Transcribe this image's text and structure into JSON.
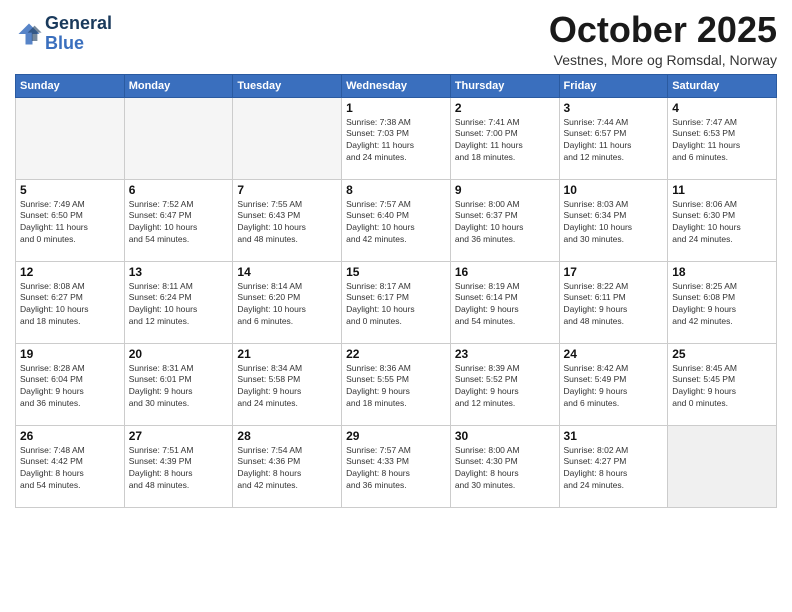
{
  "logo": {
    "line1": "General",
    "line2": "Blue"
  },
  "title": "October 2025",
  "subtitle": "Vestnes, More og Romsdal, Norway",
  "days_of_week": [
    "Sunday",
    "Monday",
    "Tuesday",
    "Wednesday",
    "Thursday",
    "Friday",
    "Saturday"
  ],
  "weeks": [
    [
      {
        "day": "",
        "info": ""
      },
      {
        "day": "",
        "info": ""
      },
      {
        "day": "",
        "info": ""
      },
      {
        "day": "1",
        "info": "Sunrise: 7:38 AM\nSunset: 7:03 PM\nDaylight: 11 hours\nand 24 minutes."
      },
      {
        "day": "2",
        "info": "Sunrise: 7:41 AM\nSunset: 7:00 PM\nDaylight: 11 hours\nand 18 minutes."
      },
      {
        "day": "3",
        "info": "Sunrise: 7:44 AM\nSunset: 6:57 PM\nDaylight: 11 hours\nand 12 minutes."
      },
      {
        "day": "4",
        "info": "Sunrise: 7:47 AM\nSunset: 6:53 PM\nDaylight: 11 hours\nand 6 minutes."
      }
    ],
    [
      {
        "day": "5",
        "info": "Sunrise: 7:49 AM\nSunset: 6:50 PM\nDaylight: 11 hours\nand 0 minutes."
      },
      {
        "day": "6",
        "info": "Sunrise: 7:52 AM\nSunset: 6:47 PM\nDaylight: 10 hours\nand 54 minutes."
      },
      {
        "day": "7",
        "info": "Sunrise: 7:55 AM\nSunset: 6:43 PM\nDaylight: 10 hours\nand 48 minutes."
      },
      {
        "day": "8",
        "info": "Sunrise: 7:57 AM\nSunset: 6:40 PM\nDaylight: 10 hours\nand 42 minutes."
      },
      {
        "day": "9",
        "info": "Sunrise: 8:00 AM\nSunset: 6:37 PM\nDaylight: 10 hours\nand 36 minutes."
      },
      {
        "day": "10",
        "info": "Sunrise: 8:03 AM\nSunset: 6:34 PM\nDaylight: 10 hours\nand 30 minutes."
      },
      {
        "day": "11",
        "info": "Sunrise: 8:06 AM\nSunset: 6:30 PM\nDaylight: 10 hours\nand 24 minutes."
      }
    ],
    [
      {
        "day": "12",
        "info": "Sunrise: 8:08 AM\nSunset: 6:27 PM\nDaylight: 10 hours\nand 18 minutes."
      },
      {
        "day": "13",
        "info": "Sunrise: 8:11 AM\nSunset: 6:24 PM\nDaylight: 10 hours\nand 12 minutes."
      },
      {
        "day": "14",
        "info": "Sunrise: 8:14 AM\nSunset: 6:20 PM\nDaylight: 10 hours\nand 6 minutes."
      },
      {
        "day": "15",
        "info": "Sunrise: 8:17 AM\nSunset: 6:17 PM\nDaylight: 10 hours\nand 0 minutes."
      },
      {
        "day": "16",
        "info": "Sunrise: 8:19 AM\nSunset: 6:14 PM\nDaylight: 9 hours\nand 54 minutes."
      },
      {
        "day": "17",
        "info": "Sunrise: 8:22 AM\nSunset: 6:11 PM\nDaylight: 9 hours\nand 48 minutes."
      },
      {
        "day": "18",
        "info": "Sunrise: 8:25 AM\nSunset: 6:08 PM\nDaylight: 9 hours\nand 42 minutes."
      }
    ],
    [
      {
        "day": "19",
        "info": "Sunrise: 8:28 AM\nSunset: 6:04 PM\nDaylight: 9 hours\nand 36 minutes."
      },
      {
        "day": "20",
        "info": "Sunrise: 8:31 AM\nSunset: 6:01 PM\nDaylight: 9 hours\nand 30 minutes."
      },
      {
        "day": "21",
        "info": "Sunrise: 8:34 AM\nSunset: 5:58 PM\nDaylight: 9 hours\nand 24 minutes."
      },
      {
        "day": "22",
        "info": "Sunrise: 8:36 AM\nSunset: 5:55 PM\nDaylight: 9 hours\nand 18 minutes."
      },
      {
        "day": "23",
        "info": "Sunrise: 8:39 AM\nSunset: 5:52 PM\nDaylight: 9 hours\nand 12 minutes."
      },
      {
        "day": "24",
        "info": "Sunrise: 8:42 AM\nSunset: 5:49 PM\nDaylight: 9 hours\nand 6 minutes."
      },
      {
        "day": "25",
        "info": "Sunrise: 8:45 AM\nSunset: 5:45 PM\nDaylight: 9 hours\nand 0 minutes."
      }
    ],
    [
      {
        "day": "26",
        "info": "Sunrise: 7:48 AM\nSunset: 4:42 PM\nDaylight: 8 hours\nand 54 minutes."
      },
      {
        "day": "27",
        "info": "Sunrise: 7:51 AM\nSunset: 4:39 PM\nDaylight: 8 hours\nand 48 minutes."
      },
      {
        "day": "28",
        "info": "Sunrise: 7:54 AM\nSunset: 4:36 PM\nDaylight: 8 hours\nand 42 minutes."
      },
      {
        "day": "29",
        "info": "Sunrise: 7:57 AM\nSunset: 4:33 PM\nDaylight: 8 hours\nand 36 minutes."
      },
      {
        "day": "30",
        "info": "Sunrise: 8:00 AM\nSunset: 4:30 PM\nDaylight: 8 hours\nand 30 minutes."
      },
      {
        "day": "31",
        "info": "Sunrise: 8:02 AM\nSunset: 4:27 PM\nDaylight: 8 hours\nand 24 minutes."
      },
      {
        "day": "",
        "info": ""
      }
    ]
  ]
}
